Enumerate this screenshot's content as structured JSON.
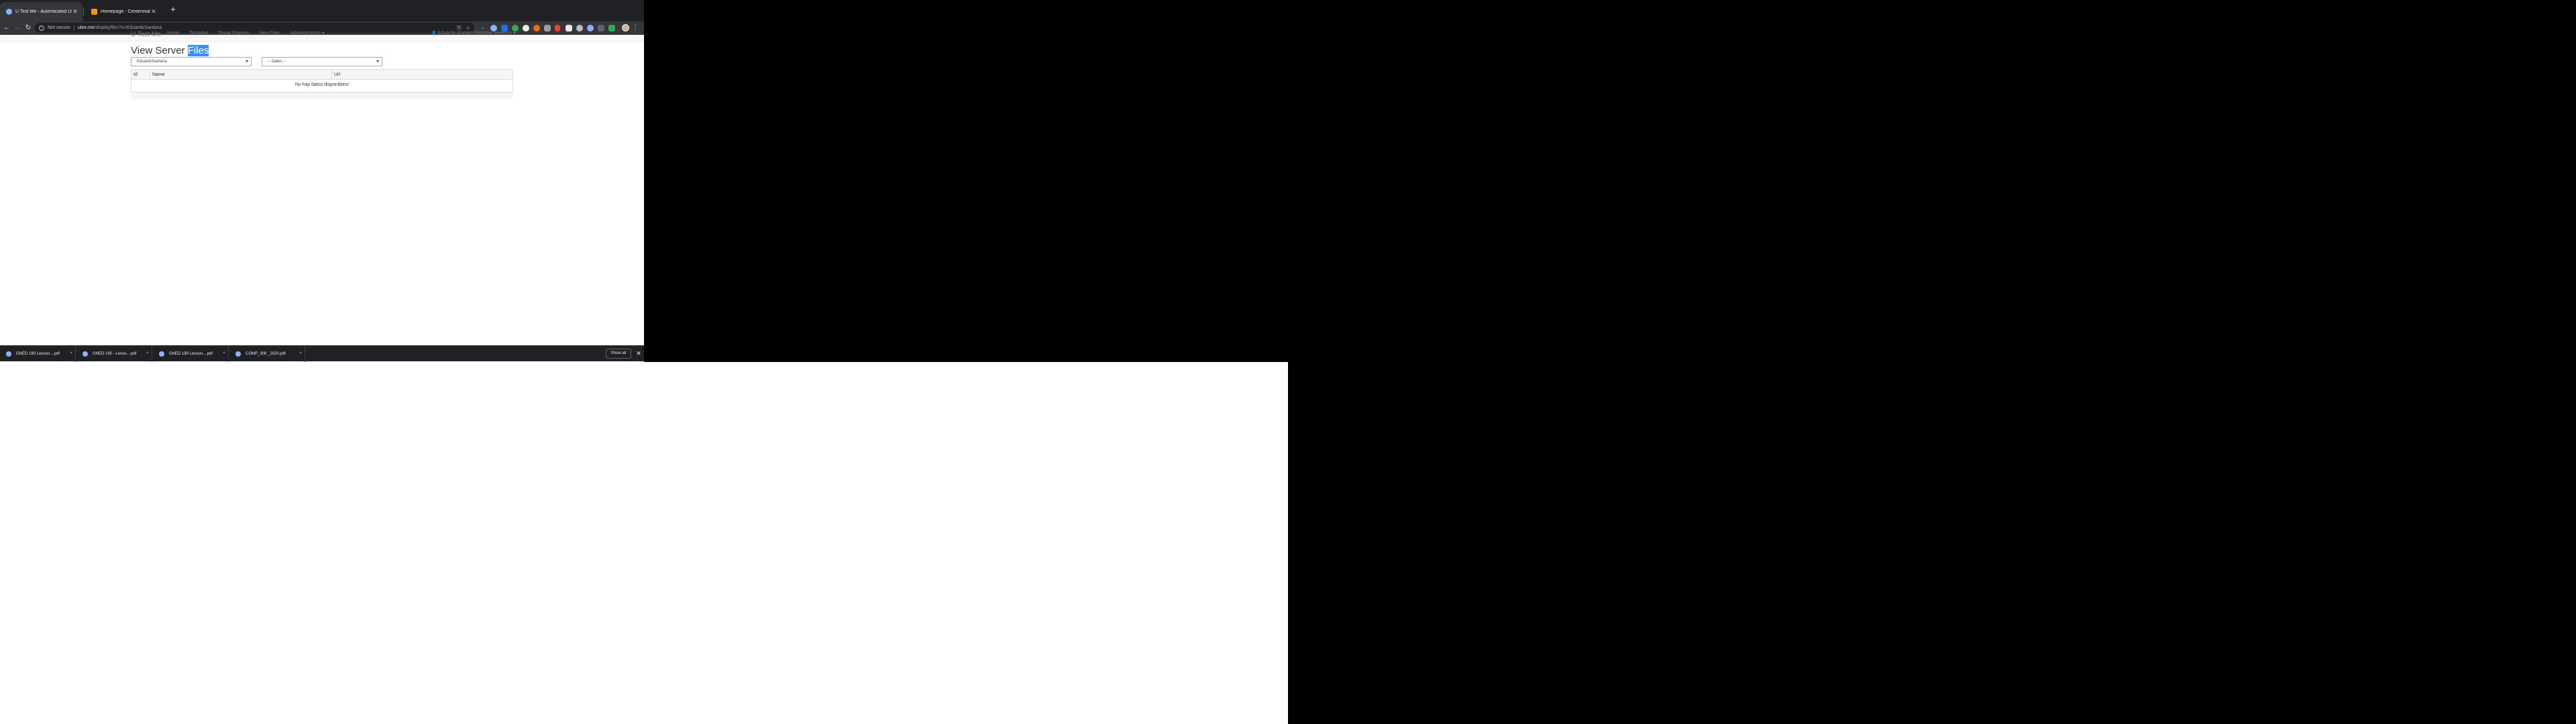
{
  "browser": {
    "tabs": [
      {
        "title": "U Test Me - Autenticated User",
        "active": true
      },
      {
        "title": "Homepage - Centennial College",
        "active": false
      }
    ],
    "new_tab_icon": "plus-icon",
    "window_controls": {
      "minimize": "–",
      "maximize": "❐",
      "close": "✕"
    },
    "omnibox": {
      "security_label": "Not secure",
      "url_host": "utex.me",
      "url_path": "/displayfiles?u=EduardoSantana"
    },
    "nav_glyphs": {
      "back": "←",
      "forward": "→",
      "reload": "↻",
      "menu": "⋮"
    }
  },
  "app": {
    "brand": "U Test Me",
    "nav": [
      {
        "label": "Home"
      },
      {
        "label": "Tomados"
      },
      {
        "label": "Tomar Examen"
      },
      {
        "label": "View Files"
      },
      {
        "label": "Administracion"
      }
    ],
    "user_label": "Eduardo Amparo Santana Severino",
    "page_title_plain": "View Server ",
    "page_title_highlight": "Files",
    "user_select_value": "EduardoSantana",
    "dates_select_value": "-- Dates --",
    "grid": {
      "columns": [
        "Id",
        "Name",
        "Url"
      ],
      "empty_message": "No hay datos disponibles!"
    }
  },
  "downloads": {
    "items": [
      {
        "name": "GNED 190 Lesson....pdf"
      },
      {
        "name": "GNED 190 - Lesso....pdf"
      },
      {
        "name": "GNED 190 Lesson....pdf"
      },
      {
        "name": "COMP_308 _2020.pdf"
      }
    ],
    "show_all": "Show all",
    "close_glyph": "✕",
    "chevron_glyph": "^"
  },
  "colors": {
    "chrome_dark": "#202124",
    "toolbar": "#35363a",
    "selection": "#3390ff",
    "navbar_bg": "#f8f8f8"
  }
}
